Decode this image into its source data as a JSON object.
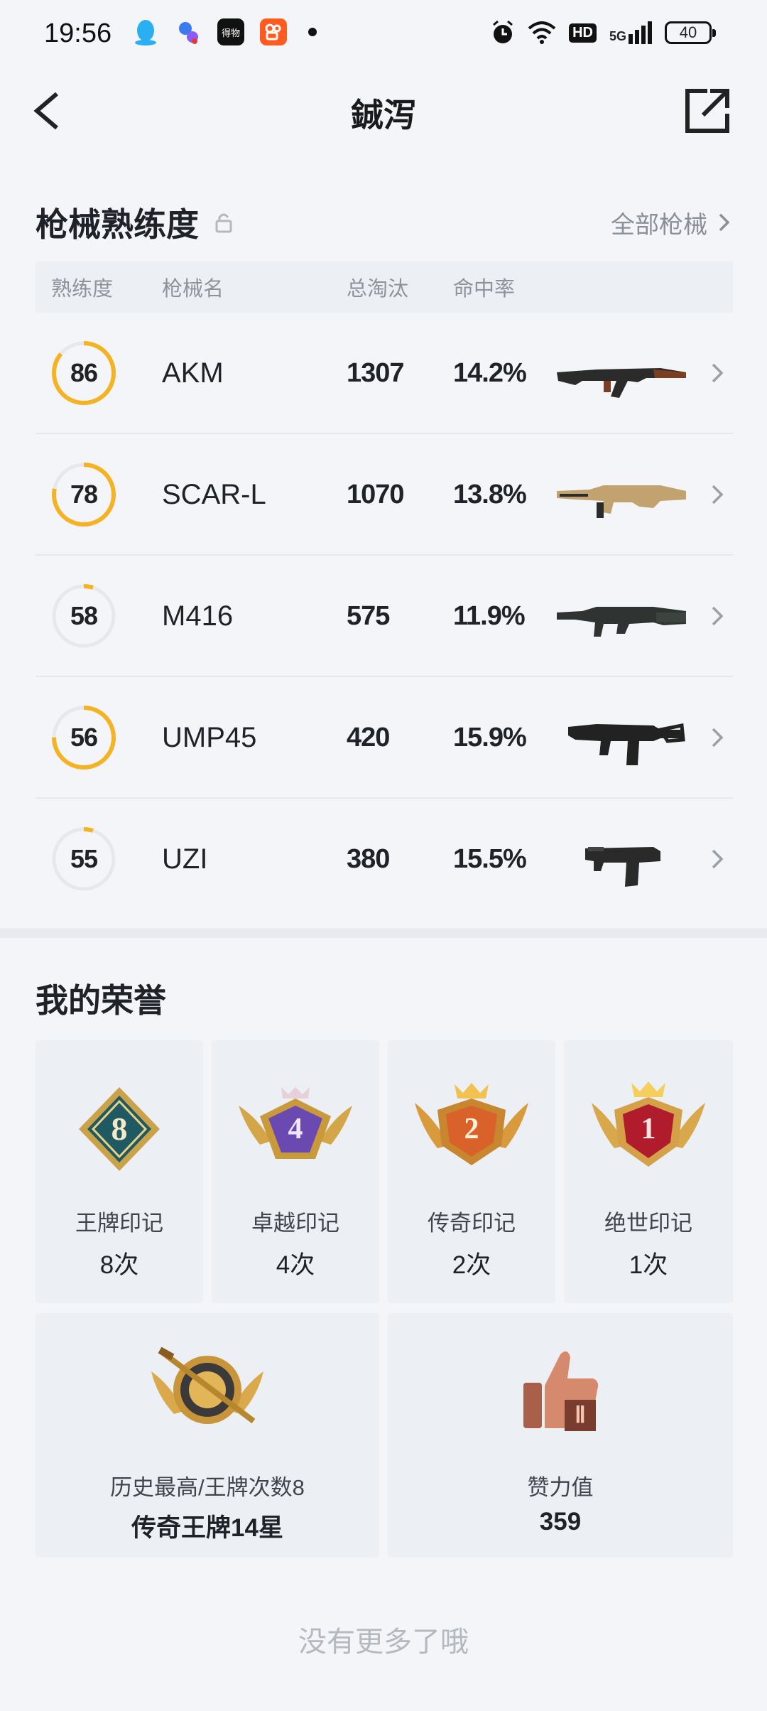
{
  "status_bar": {
    "time": "19:56",
    "hd": "HD",
    "network": "5G",
    "battery": "40",
    "app3_label": "得物"
  },
  "header": {
    "title": "鋮泻"
  },
  "weapons": {
    "title": "枪械熟练度",
    "all_link": "全部枪械",
    "columns": [
      "熟练度",
      "枪械名",
      "总淘汰",
      "命中率"
    ],
    "rows": [
      {
        "mastery": "86",
        "mastery_level": 86,
        "name": "AKM",
        "kills": "1307",
        "accuracy": "14.2%",
        "ring_color": "#f5b324",
        "gun_icon": "akm-rifle-icon"
      },
      {
        "mastery": "78",
        "mastery_level": 78,
        "name": "SCAR-L",
        "kills": "1070",
        "accuracy": "13.8%",
        "ring_color": "#f5b324",
        "gun_icon": "scar-rifle-icon"
      },
      {
        "mastery": "58",
        "mastery_level": 5,
        "name": "M416",
        "kills": "575",
        "accuracy": "11.9%",
        "ring_color": "#f5b324",
        "gun_icon": "m416-rifle-icon"
      },
      {
        "mastery": "56",
        "mastery_level": 75,
        "name": "UMP45",
        "kills": "420",
        "accuracy": "15.9%",
        "ring_color": "#f5b324",
        "gun_icon": "ump45-smg-icon"
      },
      {
        "mastery": "55",
        "mastery_level": 5,
        "name": "UZI",
        "kills": "380",
        "accuracy": "15.5%",
        "ring_color": "#f5b324",
        "gun_icon": "uzi-smg-icon"
      }
    ]
  },
  "honors": {
    "title": "我的荣誉",
    "cards": [
      {
        "label": "王牌印记",
        "value": "8次",
        "badge_number": "8",
        "badge_icon": "ace-mark-badge-icon"
      },
      {
        "label": "卓越印记",
        "value": "4次",
        "badge_number": "4",
        "badge_icon": "excellence-mark-badge-icon"
      },
      {
        "label": "传奇印记",
        "value": "2次",
        "badge_number": "2",
        "badge_icon": "legend-mark-badge-icon"
      },
      {
        "label": "绝世印记",
        "value": "1次",
        "badge_number": "1",
        "badge_icon": "peerless-mark-badge-icon"
      }
    ],
    "wide_cards": [
      {
        "label": "历史最高/王牌次数8",
        "value": "传奇王牌14星",
        "badge_icon": "highest-rank-badge-icon"
      },
      {
        "label": "赞力值",
        "value": "359",
        "badge_icon": "thumbs-up-badge-icon"
      }
    ]
  },
  "footer": {
    "text": "没有更多了哦"
  },
  "colors": {
    "ring_active": "#f5b324",
    "ring_track": "#e6e8ec",
    "background": "#f3f5f9"
  }
}
